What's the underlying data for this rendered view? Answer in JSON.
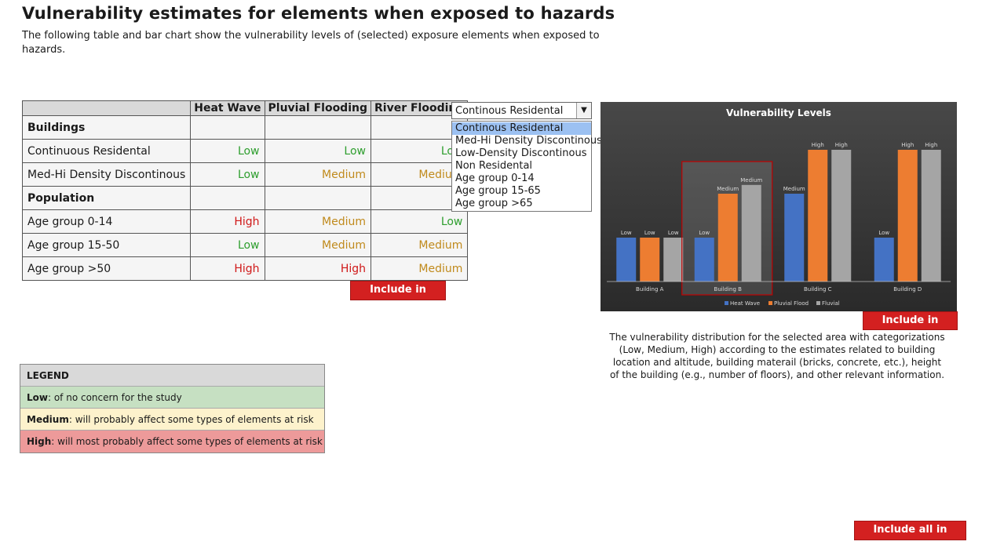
{
  "page": {
    "title": "Vulnerability estimates for elements when exposed to hazards",
    "subtitle": "The following table and bar chart show the vulnerability levels of (selected) exposure elements when exposed to hazards."
  },
  "table": {
    "headers": [
      "Heat Wave",
      "Pluvial Flooding",
      "River Flooding"
    ],
    "rows": [
      {
        "label": "Buildings",
        "category": true,
        "values": [
          "",
          "",
          ""
        ]
      },
      {
        "label": "Continuous Residental",
        "values": [
          "Low",
          "Low",
          "Low"
        ]
      },
      {
        "label": "Med-Hi Density Discontinous",
        "values": [
          "Low",
          "Medium",
          "Medium"
        ]
      },
      {
        "label": "Population",
        "category": true,
        "values": [
          "",
          "",
          ""
        ]
      },
      {
        "label": "Age group 0-14",
        "values": [
          "High",
          "Medium",
          "Low"
        ]
      },
      {
        "label": "Age group 15-50",
        "values": [
          "Low",
          "Medium",
          "Medium"
        ]
      },
      {
        "label": "Age group >50",
        "values": [
          "High",
          "High",
          "Medium"
        ]
      }
    ],
    "include_button": "Include in Report"
  },
  "dropdown": {
    "selected": "Continous Residental",
    "options": [
      "Continous Residental",
      "Med-Hi Density Discontinous",
      "Low-Density Discontinous",
      "Non Residental",
      "Age group 0-14",
      "Age group 15-65",
      "Age group >65"
    ]
  },
  "chart": {
    "include_button": "Include in Report",
    "caption": "The vulnerability distribution for the selected area with categorizations (Low, Medium, High) according to the estimates related to building location and altitude, building materail (bricks, concrete, etc.), height of the building (e.g., number of floors), and other relevant information.",
    "highlighted_category": "Building B",
    "colors": {
      "Heat Wave": "#4472c4",
      "Pluvial Flood": "#ed7d31",
      "Fluvial": "#a5a5a5",
      "highlight": "#c00000"
    }
  },
  "chart_data": {
    "type": "bar",
    "title": "Vulnerability Levels",
    "categories": [
      "Building A",
      "Building B",
      "Building C",
      "Building D"
    ],
    "level_scale": {
      "Low": 1,
      "Medium": 2,
      "High": 3
    },
    "series": [
      {
        "name": "Heat Wave",
        "values": [
          1,
          1,
          2,
          1
        ],
        "labels": [
          "Low",
          "Low",
          "Medium",
          "Low"
        ]
      },
      {
        "name": "Pluvial Flood",
        "values": [
          1,
          2,
          3,
          3
        ],
        "labels": [
          "Low",
          "Medium",
          "High",
          "High"
        ]
      },
      {
        "name": "Fluvial",
        "values": [
          1,
          2.2,
          3,
          3
        ],
        "labels": [
          "Low",
          "Medium",
          "High",
          "High"
        ]
      }
    ],
    "xlabel": "",
    "ylabel": "",
    "grid": false,
    "legend": "bottom"
  },
  "legend": {
    "header": "LEGEND",
    "items": [
      {
        "term": "Low",
        "text": ": of no concern for the study"
      },
      {
        "term": "Medium",
        "text": ": will probably affect some types of elements at risk"
      },
      {
        "term": "High",
        "text": ": will most probably affect some types of elements at risk"
      }
    ]
  },
  "footer": {
    "include_all_button": "Include all in Report"
  }
}
